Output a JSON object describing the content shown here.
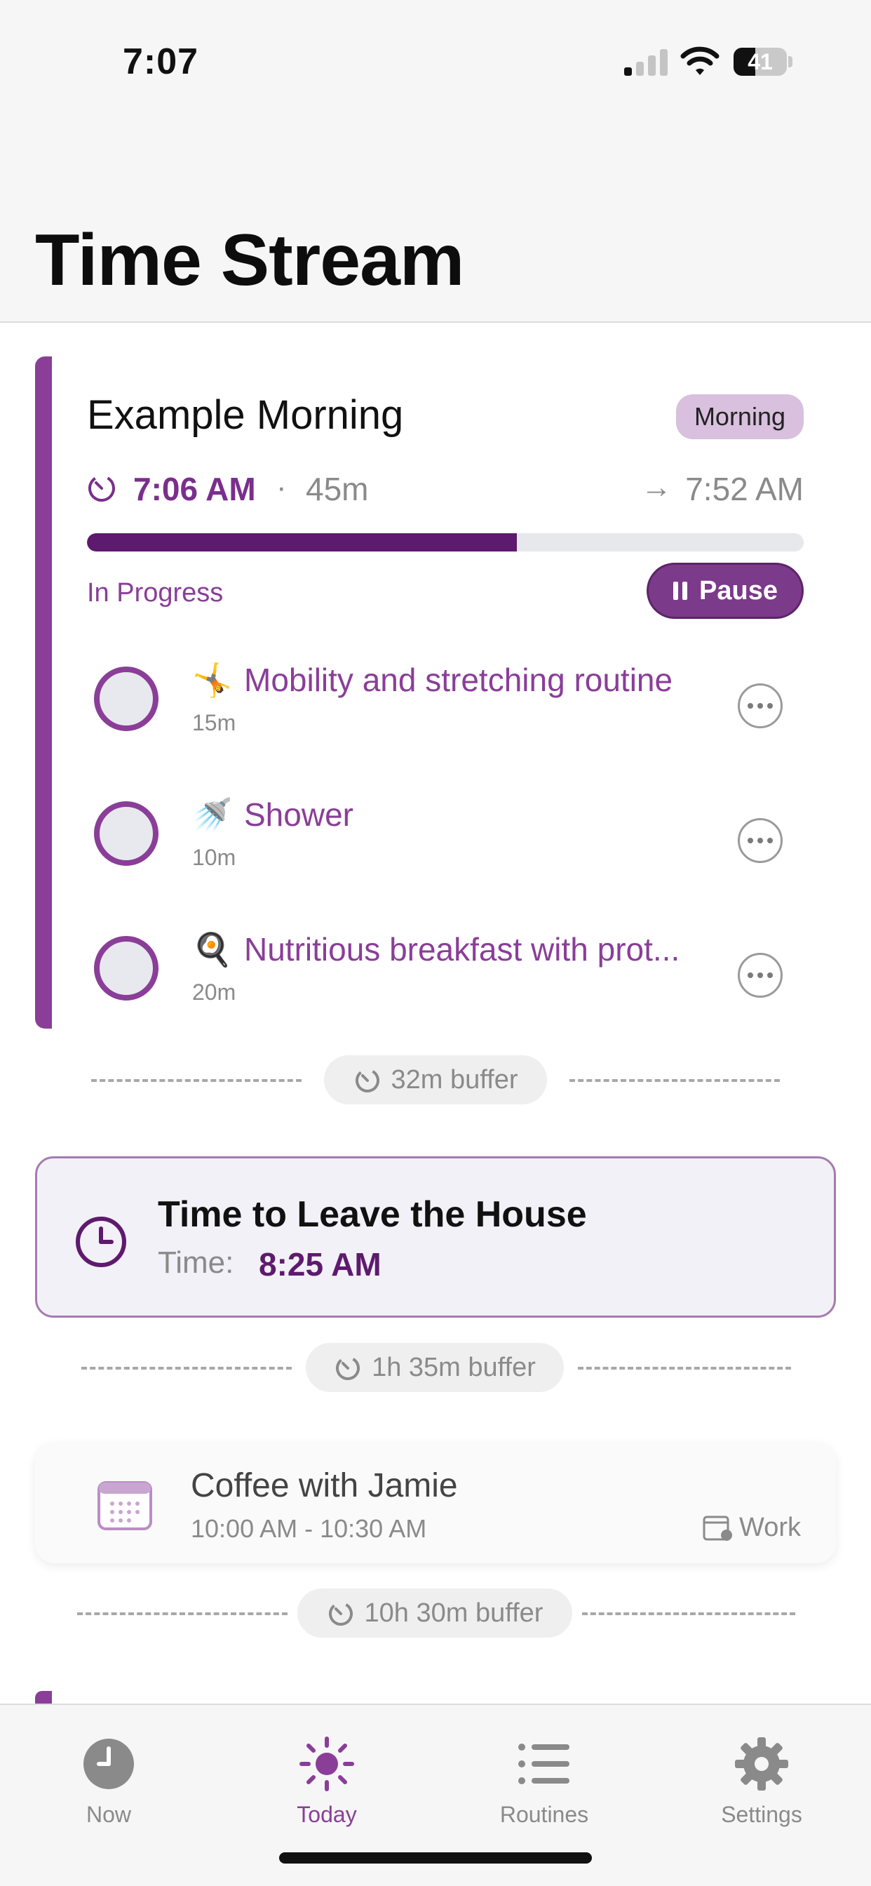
{
  "status_bar": {
    "time": "7:07",
    "battery": "41",
    "battery_level": 0.41,
    "signal_bars_active": 1,
    "icons": [
      "cellular-signal-icon",
      "wifi-icon",
      "battery-icon"
    ]
  },
  "header": {
    "title": "Time Stream"
  },
  "routine": {
    "title": "Example Morning",
    "badge": "Morning",
    "start_time": "7:06 AM",
    "separator": "·",
    "duration": "45m",
    "arrow": "→",
    "end_time": "7:52 AM",
    "progress_fraction": 0.6,
    "status": "In Progress",
    "pause_label": "Pause",
    "accent_color": "#8a3e98",
    "tasks": [
      {
        "emoji": "🤸",
        "name": "Mobility and stretching routine",
        "duration": "15m"
      },
      {
        "emoji": "🚿",
        "name": "Shower",
        "duration": "10m"
      },
      {
        "emoji": "🍳",
        "name": "Nutritious breakfast with prot...",
        "duration": "20m"
      }
    ]
  },
  "buffers": [
    {
      "label": "32m buffer"
    },
    {
      "label": "1h 35m buffer"
    },
    {
      "label": "10h 30m buffer"
    }
  ],
  "alarm": {
    "title": "Time to Leave the House",
    "time_label": "Time:",
    "time": "8:25 AM",
    "icon": "clock-icon"
  },
  "event": {
    "title": "Coffee with Jamie",
    "time_range": "10:00 AM - 10:30 AM",
    "calendar": "Work",
    "icon": "calendar-icon"
  },
  "tabs": [
    {
      "label": "Now",
      "icon": "clock-icon",
      "active": false
    },
    {
      "label": "Today",
      "icon": "sun-icon",
      "active": true
    },
    {
      "label": "Routines",
      "icon": "list-icon",
      "active": false
    },
    {
      "label": "Settings",
      "icon": "gear-icon",
      "active": false
    }
  ]
}
